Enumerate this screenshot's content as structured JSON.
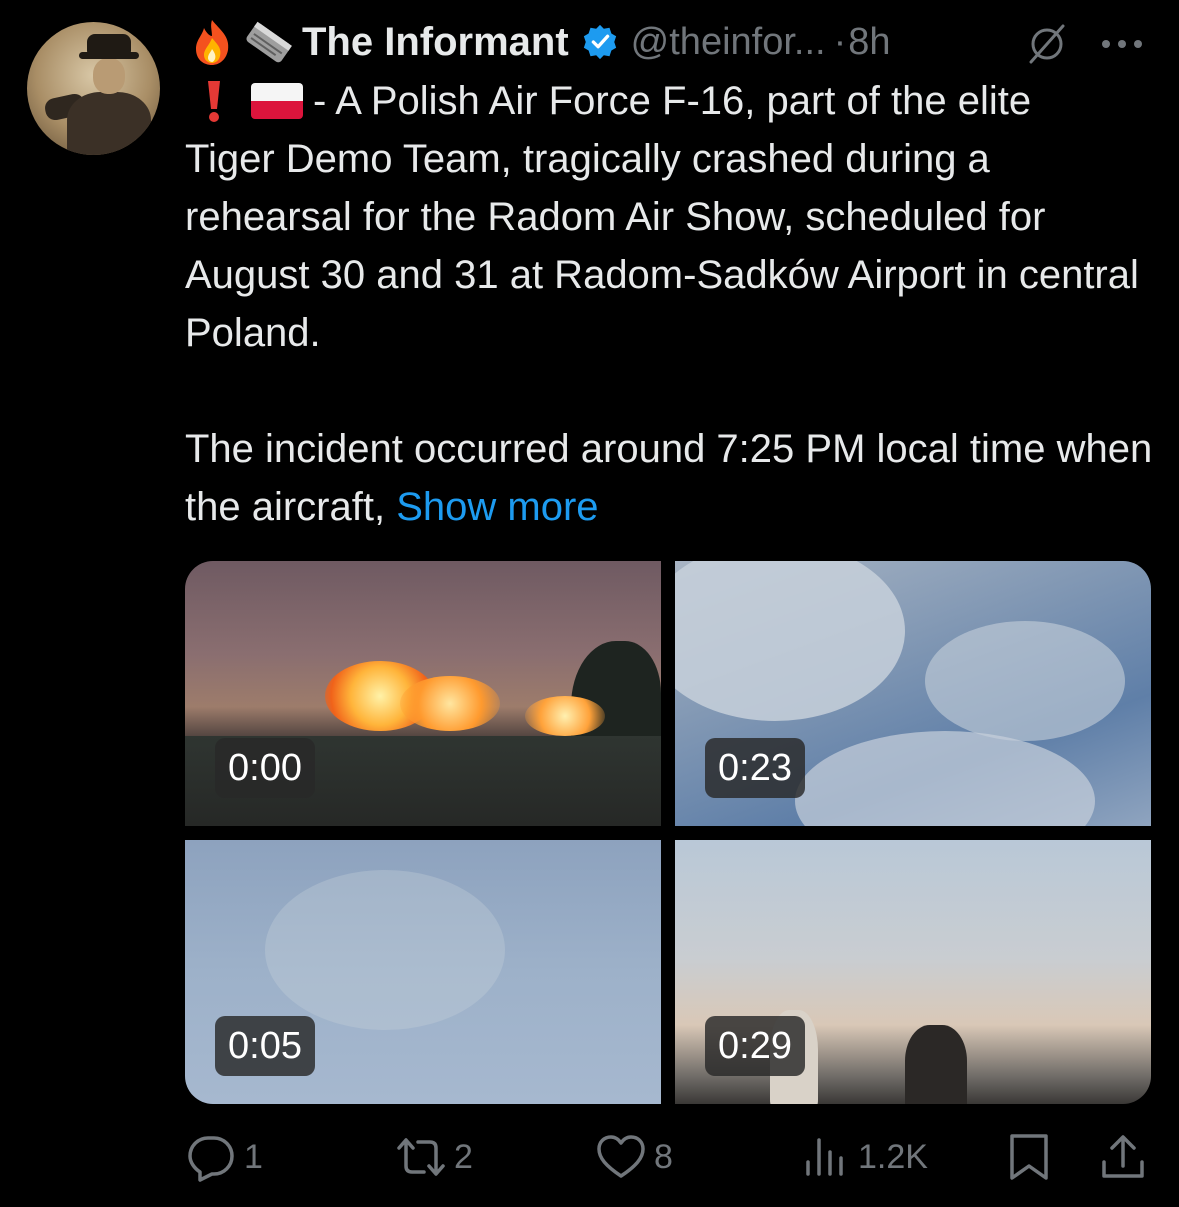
{
  "tweet": {
    "author": {
      "display_name": "The Informant",
      "handle": "@theinfor...",
      "time": "8h",
      "verified": true,
      "name_emojis": [
        "fire-icon",
        "newspaper-icon"
      ]
    },
    "text": {
      "lead_icons": [
        "exclaim-icon",
        "poland-flag-icon"
      ],
      "para1_first": "- A Polish Air Force F-16, part of the elite",
      "para1_rest": "Tiger Demo Team, tragically crashed during a rehearsal for the Radom Air Show, scheduled for August 30 and 31 at Radom-Sadków Airport in central Poland.",
      "para2": "The incident occurred around 7:25 PM local time when the aircraft,",
      "show_more": "Show more"
    },
    "media": [
      {
        "duration": "0:00"
      },
      {
        "duration": "0:23"
      },
      {
        "duration": "0:05"
      },
      {
        "duration": "0:29"
      }
    ],
    "actions": {
      "replies": "1",
      "reposts": "2",
      "likes": "8",
      "views": "1.2K"
    },
    "colors": {
      "background": "#000000",
      "text": "#e7e9ea",
      "secondary": "#71767b",
      "link": "#1d9bf0",
      "verified": "#1d9bf0"
    }
  }
}
